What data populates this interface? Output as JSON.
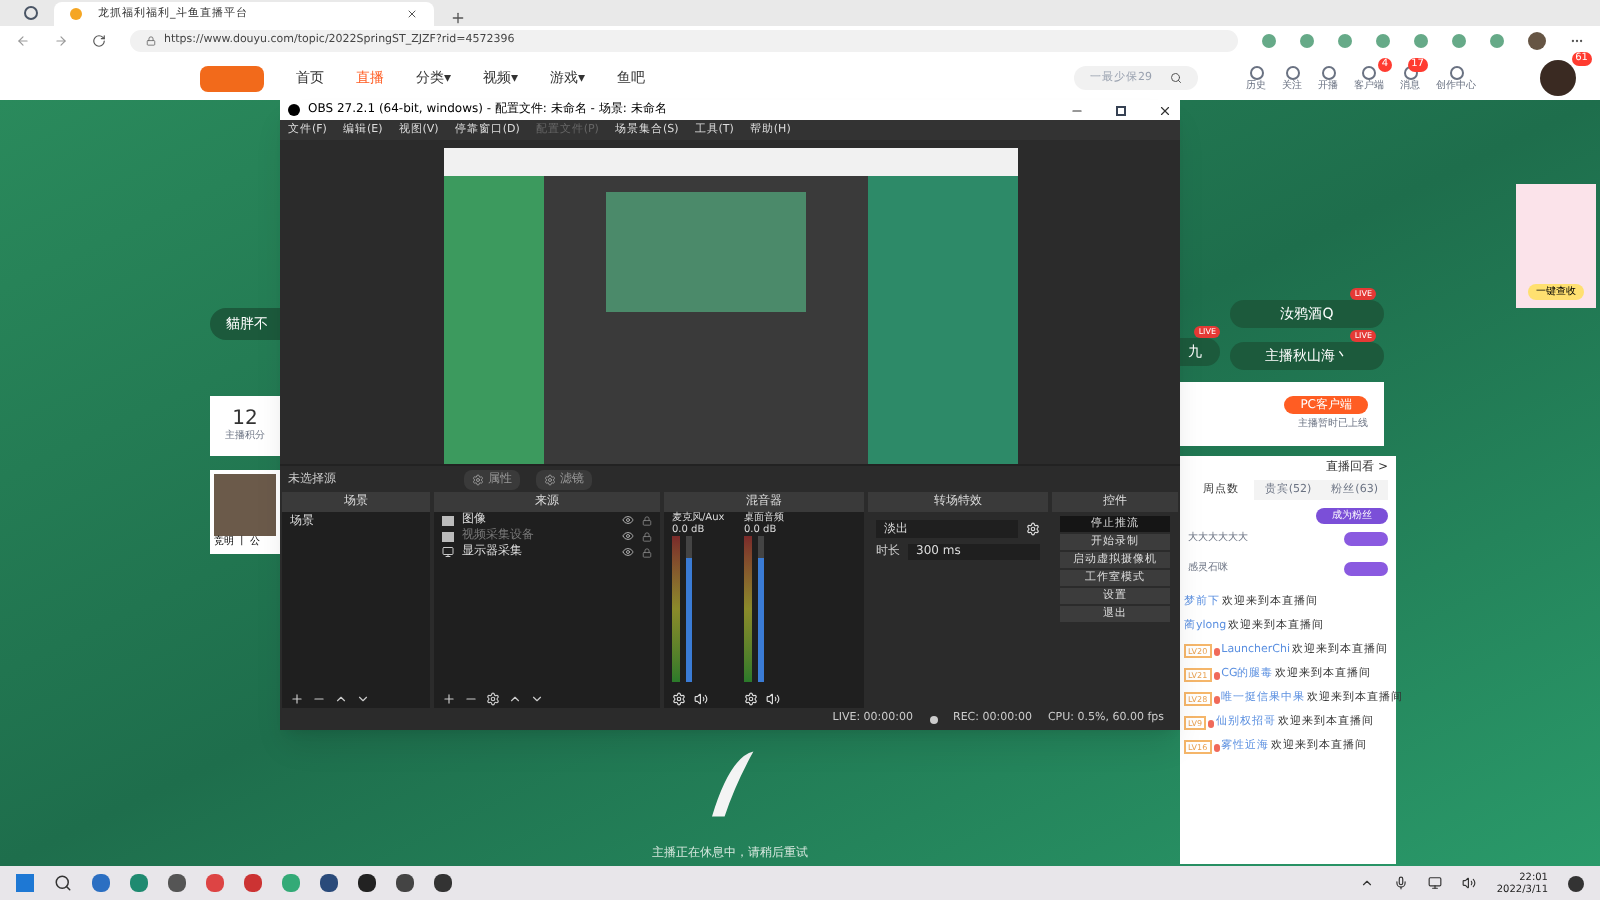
{
  "browser": {
    "tab_title": "龙抓福利福利_斗鱼直播平台",
    "url": "https://www.douyu.com/topic/2022SpringST_ZJZF?rid=4572396"
  },
  "site_nav": {
    "items": [
      {
        "label": "首页",
        "selected": false
      },
      {
        "label": "直播",
        "selected": true
      },
      {
        "label": "分类▾",
        "selected": false
      },
      {
        "label": "视频▾",
        "selected": false
      },
      {
        "label": "游戏▾",
        "selected": false
      },
      {
        "label": "鱼吧",
        "selected": false
      }
    ],
    "search": {
      "placeholder": "一最少保29"
    },
    "actions": [
      {
        "label": "历史"
      },
      {
        "label": "关注"
      },
      {
        "label": "开播"
      },
      {
        "label": "客户端",
        "badge": "4"
      },
      {
        "label": "消息",
        "badge": "17"
      },
      {
        "label": "创作中心"
      }
    ],
    "avatar_badge": "61"
  },
  "left_panel": {
    "live_button": "貓胖不",
    "score": "12",
    "score_label": "主播积分",
    "streamer_caption": "竞明 丨 公"
  },
  "right_panel": {
    "live_buttons": [
      {
        "label": "汝鸦酒Q",
        "badge": "LIVE"
      },
      {
        "label": "主播秋山海丶",
        "badge": "LIVE"
      }
    ],
    "partial_button": {
      "label": "九",
      "badge": "LIVE"
    },
    "client_button": "PC客户端",
    "client_note": "主播暂时已上线",
    "replay_link": "直播回看 >",
    "chat_tabs": [
      {
        "label": "周点数",
        "selected": true
      },
      {
        "label": "贵宾(52)",
        "selected": false
      },
      {
        "label": "粉丝(63)",
        "selected": false
      }
    ],
    "fan_button": "成为粉丝",
    "ranks": [
      {
        "name": "大大大大大大"
      },
      {
        "name": "感灵石咪"
      }
    ],
    "messages": [
      {
        "name": "梦前下",
        "text": "欢迎来到本直播间"
      },
      {
        "name": "蔺ylong",
        "text": "欢迎来到本直播间"
      },
      {
        "level": "LV20",
        "name": "LauncherChi",
        "text": "欢迎来到本直播间"
      },
      {
        "level": "LV21",
        "name": "CG的腿毒",
        "text": "欢迎来到本直播间"
      },
      {
        "level": "LV28",
        "name": "唯一挺信果中果",
        "text": "欢迎来到本直播间"
      },
      {
        "level": "LV9",
        "name": "仙别权招哥",
        "text": "欢迎来到本直播间"
      },
      {
        "level": "LV16",
        "name": "雾性近海",
        "text": "欢迎来到本直播间"
      }
    ],
    "ad_button": "一键查收"
  },
  "offline_note": "主播正在休息中，请稍后重试",
  "obs": {
    "title": "OBS 27.2.1 (64-bit, windows) - 配置文件: 未命名 - 场景: 未命名",
    "menu": [
      {
        "label": "文件(F)",
        "disabled": false
      },
      {
        "label": "编辑(E)",
        "disabled": false
      },
      {
        "label": "视图(V)",
        "disabled": false
      },
      {
        "label": "停靠窗口(D)",
        "disabled": false
      },
      {
        "label": "配置文件(P)",
        "disabled": true
      },
      {
        "label": "场景集合(S)",
        "disabled": false
      },
      {
        "label": "工具(T)",
        "disabled": false
      },
      {
        "label": "帮助(H)",
        "disabled": false
      }
    ],
    "source_toolbar": {
      "label": "未选择源",
      "buttons": [
        "属性",
        "滤镜"
      ]
    },
    "scenes": {
      "title": "场景",
      "items": [
        "场景"
      ]
    },
    "sources": {
      "title": "来源",
      "items": [
        {
          "name": "图像",
          "enabled": true,
          "kind": "image"
        },
        {
          "name": "视频采集设备",
          "enabled": false,
          "kind": "camera"
        },
        {
          "name": "显示器采集",
          "enabled": true,
          "kind": "display"
        }
      ]
    },
    "mixer": {
      "title": "混音器",
      "channels": [
        {
          "name": "麦克风/Aux",
          "reading": "0.0 dB",
          "level": 0.85
        },
        {
          "name": "桌面音频",
          "reading": "0.0 dB",
          "level": 0.85
        }
      ]
    },
    "transitions": {
      "title": "转场特效",
      "value": "淡出",
      "duration_label": "时长",
      "duration": "300 ms"
    },
    "controls": {
      "title": "控件",
      "buttons": [
        {
          "label": "停止推流",
          "active": true
        },
        {
          "label": "开始录制",
          "active": false
        },
        {
          "label": "启动虚拟摄像机",
          "active": false
        },
        {
          "label": "工作室模式",
          "active": false
        },
        {
          "label": "设置",
          "active": false
        },
        {
          "label": "退出",
          "active": false
        }
      ]
    },
    "status": {
      "live": "LIVE: 00:00:00",
      "rec": "REC: 00:00:00",
      "cpu": "CPU: 0.5%, 60.00 fps"
    }
  },
  "taskbar": {
    "time": "22:01",
    "date": "2022/3/11"
  }
}
